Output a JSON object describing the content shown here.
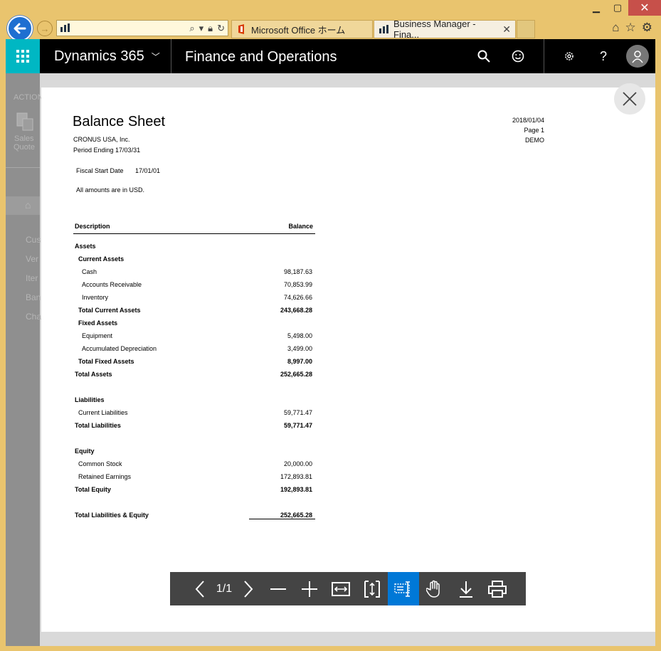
{
  "browser": {
    "tabs": [
      {
        "label": "Microsoft Office ホーム",
        "icon": "office-icon"
      },
      {
        "label": "Business Manager - Fina...",
        "icon": "dynamics-icon",
        "close": "✕"
      }
    ]
  },
  "appbar": {
    "brand": "Dynamics 365",
    "module": "Finance and Operations"
  },
  "sidebar": {
    "action_label": "ACTION",
    "sales_quote_line1": "Sales",
    "sales_quote_line2": "Quote",
    "nav_items": [
      "Cus",
      "Ver",
      "Iter",
      "Ban",
      "Cha"
    ]
  },
  "report": {
    "title": "Balance Sheet",
    "company": "CRONUS USA, Inc.",
    "period": "Period Ending 17/03/31",
    "date": "2018/01/04",
    "page": "Page 1",
    "user": "DEMO",
    "fiscal_label": "Fiscal Start Date",
    "fiscal_value": "17/01/01",
    "amounts_note": "All amounts are in USD.",
    "col_description": "Description",
    "col_balance": "Balance",
    "rows": [
      {
        "label": "Assets",
        "value": "",
        "indent": 0,
        "bold": true
      },
      {
        "label": "Current Assets",
        "value": "",
        "indent": 1,
        "bold": true
      },
      {
        "label": "Cash",
        "value": "98,187.63",
        "indent": 2,
        "bold": false
      },
      {
        "label": "Accounts Receivable",
        "value": "70,853.99",
        "indent": 2,
        "bold": false
      },
      {
        "label": "Inventory",
        "value": "74,626.66",
        "indent": 2,
        "bold": false
      },
      {
        "label": "Total Current Assets",
        "value": "243,668.28",
        "indent": 1,
        "bold": true
      },
      {
        "label": "Fixed Assets",
        "value": "",
        "indent": 1,
        "bold": true
      },
      {
        "label": "Equipment",
        "value": "5,498.00",
        "indent": 2,
        "bold": false
      },
      {
        "label": "Accumulated Depreciation",
        "value": "3,499.00",
        "indent": 2,
        "bold": false
      },
      {
        "label": "Total Fixed Assets",
        "value": "8,997.00",
        "indent": 1,
        "bold": true
      },
      {
        "label": "Total Assets",
        "value": "252,665.28",
        "indent": 0,
        "bold": true
      },
      {
        "label": "",
        "value": "",
        "indent": 0,
        "bold": false
      },
      {
        "label": "Liabilities",
        "value": "",
        "indent": 0,
        "bold": true
      },
      {
        "label": "Current Liabilities",
        "value": "59,771.47",
        "indent": 1,
        "bold": false
      },
      {
        "label": "Total Liabilities",
        "value": "59,771.47",
        "indent": 0,
        "bold": true
      },
      {
        "label": "",
        "value": "",
        "indent": 0,
        "bold": false
      },
      {
        "label": "Equity",
        "value": "",
        "indent": 0,
        "bold": true
      },
      {
        "label": "Common Stock",
        "value": "20,000.00",
        "indent": 1,
        "bold": false
      },
      {
        "label": "Retained Earnings",
        "value": "172,893.81",
        "indent": 1,
        "bold": false
      },
      {
        "label": "Total Equity",
        "value": "192,893.81",
        "indent": 0,
        "bold": true
      },
      {
        "label": "",
        "value": "",
        "indent": 0,
        "bold": false
      },
      {
        "label": "Total Liabilities & Equity",
        "value": "252,665.28",
        "indent": 0,
        "bold": true
      }
    ]
  },
  "pdf_toolbar": {
    "page_indicator": "1/1"
  }
}
